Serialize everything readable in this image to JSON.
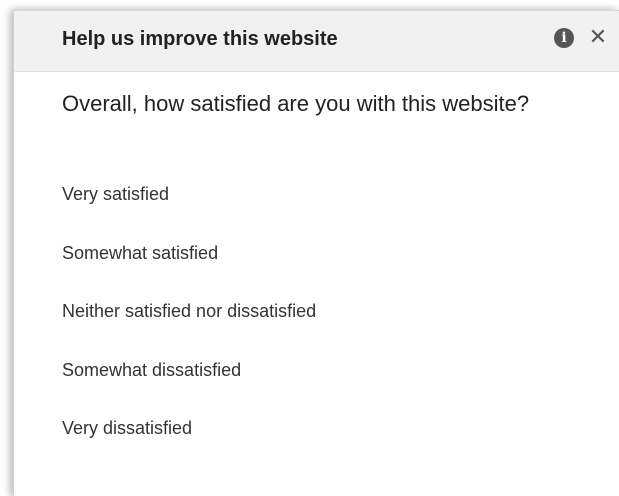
{
  "header": {
    "title": "Help us improve this website",
    "info_icon": "info-icon",
    "close_icon": "close-icon",
    "info_glyph": "i",
    "close_glyph": "✕"
  },
  "question": {
    "text": "Overall, how satisfied are you with this website?"
  },
  "options": [
    "Very satisfied",
    "Somewhat satisfied",
    "Neither satisfied nor dissatisfied",
    "Somewhat dissatisfied",
    "Very dissatisfied"
  ],
  "colors": {
    "header_bg": "#f1f1f1",
    "title_text": "#222222",
    "option_text": "#333333",
    "icon": "#555555"
  }
}
